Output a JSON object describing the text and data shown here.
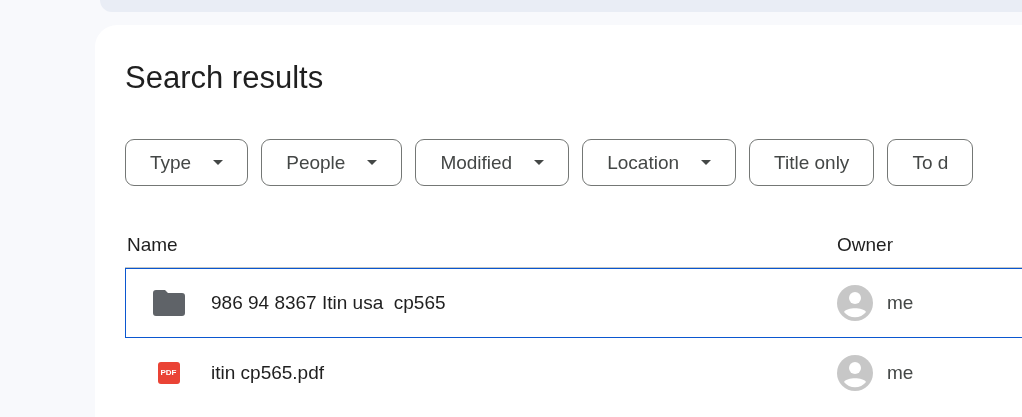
{
  "title": "Search results",
  "filters": [
    {
      "label": "Type",
      "dropdown": true
    },
    {
      "label": "People",
      "dropdown": true
    },
    {
      "label": "Modified",
      "dropdown": true
    },
    {
      "label": "Location",
      "dropdown": true
    },
    {
      "label": "Title only",
      "dropdown": false
    },
    {
      "label": "To d",
      "dropdown": false
    }
  ],
  "table": {
    "columns": [
      "Name",
      "Owner"
    ],
    "rows": [
      {
        "kind": "folder",
        "name": "986 94 8367 Itin usa  cp565",
        "owner": "me",
        "selected": true
      },
      {
        "kind": "pdf",
        "icon_text": "PDF",
        "name": "itin cp565.pdf",
        "owner": "me",
        "selected": false
      }
    ]
  }
}
